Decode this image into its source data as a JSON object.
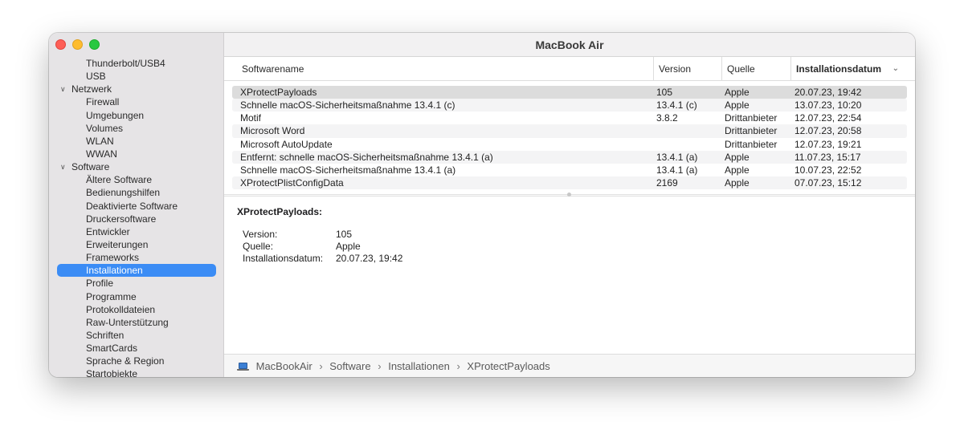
{
  "window": {
    "title": "MacBook Air"
  },
  "sidebar": {
    "items": [
      {
        "label": "Thunderbolt/USB4",
        "level": 2
      },
      {
        "label": "USB",
        "level": 2
      },
      {
        "label": "Netzwerk",
        "level": 1,
        "expanded": true
      },
      {
        "label": "Firewall",
        "level": 2
      },
      {
        "label": "Umgebungen",
        "level": 2
      },
      {
        "label": "Volumes",
        "level": 2
      },
      {
        "label": "WLAN",
        "level": 2
      },
      {
        "label": "WWAN",
        "level": 2
      },
      {
        "label": "Software",
        "level": 1,
        "expanded": true
      },
      {
        "label": "Ältere Software",
        "level": 2
      },
      {
        "label": "Bedienungshilfen",
        "level": 2
      },
      {
        "label": "Deaktivierte Software",
        "level": 2
      },
      {
        "label": "Druckersoftware",
        "level": 2
      },
      {
        "label": "Entwickler",
        "level": 2
      },
      {
        "label": "Erweiterungen",
        "level": 2
      },
      {
        "label": "Frameworks",
        "level": 2
      },
      {
        "label": "Installationen",
        "level": 2,
        "selected": true
      },
      {
        "label": "Profile",
        "level": 2
      },
      {
        "label": "Programme",
        "level": 2
      },
      {
        "label": "Protokolldateien",
        "level": 2
      },
      {
        "label": "Raw-Unterstützung",
        "level": 2
      },
      {
        "label": "Schriften",
        "level": 2
      },
      {
        "label": "SmartCards",
        "level": 2
      },
      {
        "label": "Sprache & Region",
        "level": 2
      },
      {
        "label": "Startobjekte",
        "level": 2
      }
    ]
  },
  "table": {
    "columns": [
      "Softwarename",
      "Version",
      "Quelle",
      "Installationsdatum"
    ],
    "sorted_column": "Installationsdatum",
    "rows": [
      {
        "name": "XProtectPayloads",
        "version": "105",
        "source": "Apple",
        "date": "20.07.23, 19:42",
        "selected": true
      },
      {
        "name": "Schnelle macOS-Sicherheitsmaßnahme 13.4.1 (c)",
        "version": "13.4.1 (c)",
        "source": "Apple",
        "date": "13.07.23, 10:20"
      },
      {
        "name": "Motif",
        "version": "3.8.2",
        "source": "Drittanbieter",
        "date": "12.07.23, 22:54"
      },
      {
        "name": "Microsoft Word",
        "version": "",
        "source": "Drittanbieter",
        "date": "12.07.23, 20:58"
      },
      {
        "name": "Microsoft AutoUpdate",
        "version": "",
        "source": "Drittanbieter",
        "date": "12.07.23, 19:21"
      },
      {
        "name": "Entfernt: schnelle macOS-Sicherheitsmaßnahme 13.4.1 (a)",
        "version": "13.4.1 (a)",
        "source": "Apple",
        "date": "11.07.23, 15:17"
      },
      {
        "name": "Schnelle macOS-Sicherheitsmaßnahme 13.4.1 (a)",
        "version": "13.4.1 (a)",
        "source": "Apple",
        "date": "10.07.23, 22:52"
      },
      {
        "name": "XProtectPlistConfigData",
        "version": "2169",
        "source": "Apple",
        "date": "07.07.23, 15:12"
      }
    ]
  },
  "detail": {
    "title": "XProtectPayloads:",
    "fields": [
      {
        "key": "Version:",
        "value": "105"
      },
      {
        "key": "Quelle:",
        "value": "Apple"
      },
      {
        "key": "Installationsdatum:",
        "value": "20.07.23, 19:42"
      }
    ]
  },
  "pathbar": {
    "icon": "laptop-icon",
    "crumbs": [
      "MacBookAir",
      "Software",
      "Installationen",
      "XProtectPayloads"
    ]
  }
}
